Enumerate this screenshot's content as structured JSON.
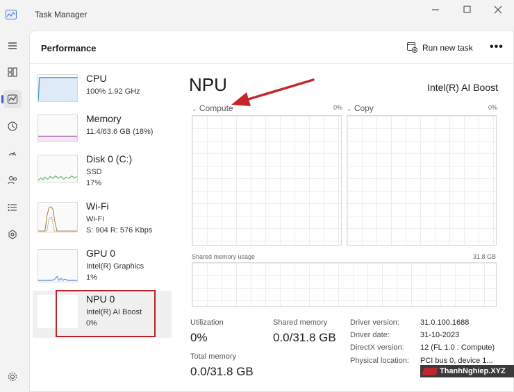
{
  "window": {
    "title": "Task Manager"
  },
  "header": {
    "page_title": "Performance",
    "run_new_task": "Run new task",
    "more": "•••"
  },
  "cards": [
    {
      "name": "CPU",
      "lines": [
        "100%  1.92 GHz"
      ]
    },
    {
      "name": "Memory",
      "lines": [
        "11.4/63.6 GB (18%)"
      ]
    },
    {
      "name": "Disk 0 (C:)",
      "lines": [
        "SSD",
        "17%"
      ]
    },
    {
      "name": "Wi-Fi",
      "lines": [
        "Wi-Fi",
        "S: 904  R: 576 Kbps"
      ]
    },
    {
      "name": "GPU 0",
      "lines": [
        "Intel(R) Graphics",
        "1%"
      ]
    },
    {
      "name": "NPU 0",
      "lines": [
        "Intel(R) AI Boost",
        "0%"
      ]
    }
  ],
  "detail": {
    "title": "NPU",
    "model": "Intel(R) AI Boost",
    "graph1": {
      "label": "Compute",
      "pct": "0%"
    },
    "graph2": {
      "label": "Copy",
      "pct": "0%"
    },
    "shared": {
      "label": "Shared memory usage",
      "max": "31.8 GB"
    },
    "stats": {
      "utilization": {
        "label": "Utilization",
        "value": "0%"
      },
      "shared_memory": {
        "label": "Shared memory",
        "value": "0.0/31.8 GB"
      },
      "total_memory": {
        "label": "Total memory",
        "value": "0.0/31.8 GB"
      }
    },
    "info": [
      {
        "label": "Driver version:",
        "value": "31.0.100.1688"
      },
      {
        "label": "Driver date:",
        "value": "31-10-2023"
      },
      {
        "label": "DirectX version:",
        "value": "12 (FL 1.0 : Compute)"
      },
      {
        "label": "Physical location:",
        "value": "PCI bus 0, device 1..."
      }
    ]
  },
  "watermark": "ThanhNghiep.XYZ",
  "colors": {
    "accent": "#3a5fcd",
    "highlight": "#b8242a",
    "cpu": "#4a8fd6",
    "memory": "#b36bb5",
    "disk": "#4aa65a",
    "wifi": "#a07840",
    "gpu": "#3f7fc9"
  },
  "icons": [
    "hamburger-icon",
    "processes-icon",
    "performance-icon",
    "app-history-icon",
    "startup-icon",
    "users-icon",
    "details-icon",
    "services-icon",
    "settings-icon",
    "run-task-icon"
  ]
}
